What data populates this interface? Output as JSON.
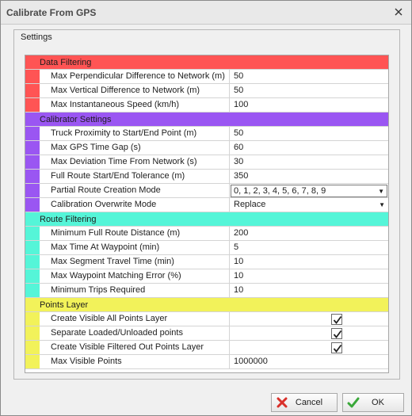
{
  "window": {
    "title": "Calibrate From GPS"
  },
  "group": {
    "title": "Settings"
  },
  "sections": [
    {
      "title": "Data Filtering",
      "color": "#ff5454",
      "rows": [
        {
          "name": "Max Perpendicular Difference to Network (m)",
          "value": "50"
        },
        {
          "name": "Max Vertical Difference to Network (m)",
          "value": "50"
        },
        {
          "name": "Max Instantaneous Speed (km/h)",
          "value": "100"
        }
      ]
    },
    {
      "title": "Calibrator Settings",
      "color": "#9a56f2",
      "rows": [
        {
          "name": "Truck Proximity to Start/End Point (m)",
          "value": "50"
        },
        {
          "name": "Max GPS Time Gap (s)",
          "value": "60"
        },
        {
          "name": "Max Deviation Time From Network (s)",
          "value": "30"
        },
        {
          "name": "Full Route Start/End Tolerance (m)",
          "value": "350"
        },
        {
          "name": "Partial Route Creation Mode",
          "value": "0, 1, 2, 3, 4, 5, 6, 7, 8, 9"
        },
        {
          "name": "Calibration Overwrite Mode",
          "value": "Replace"
        }
      ]
    },
    {
      "title": "Route Filtering",
      "color": "#55f5d8",
      "rows": [
        {
          "name": "Minimum Full Route Distance (m)",
          "value": "200"
        },
        {
          "name": "Max Time At Waypoint (min)",
          "value": "5"
        },
        {
          "name": "Max Segment Travel Time (min)",
          "value": "10"
        },
        {
          "name": "Max Waypoint Matching Error (%)",
          "value": "10"
        },
        {
          "name": "Minimum Trips Required",
          "value": "10"
        }
      ]
    },
    {
      "title": "Points Layer",
      "color": "#f2f25a",
      "rows": [
        {
          "name": "Create Visible All Points Layer",
          "checked": true
        },
        {
          "name": "Separate Loaded/Unloaded points",
          "checked": true
        },
        {
          "name": "Create Visible Filtered Out Points Layer",
          "checked": true
        },
        {
          "name": "Max Visible Points",
          "value": "1000000"
        }
      ]
    }
  ],
  "buttons": {
    "cancel": "Cancel",
    "ok": "OK"
  },
  "icons": {
    "close": "close-icon",
    "cancel": "cancel-x-icon",
    "ok": "checkmark-icon"
  }
}
